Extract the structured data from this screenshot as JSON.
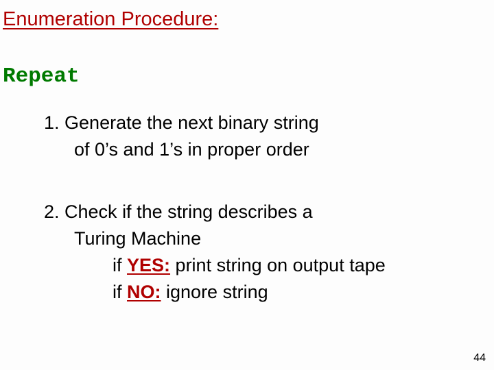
{
  "title": "Enumeration Procedure:",
  "repeat": "Repeat",
  "step1": {
    "num": "1.  ",
    "line1": "Generate the next binary string",
    "line2": "of 0’s and 1’s in proper order"
  },
  "step2": {
    "num": "2.  ",
    "line1": "Check if the string describes a",
    "line2": "Turing Machine",
    "line3_prefix": "if ",
    "yes_label": "YES:",
    "line3_suffix": " print string on output tape",
    "line4_prefix": "if ",
    "no_label": "NO:",
    "line4_suffix": "  ignore string"
  },
  "page_number": "44"
}
